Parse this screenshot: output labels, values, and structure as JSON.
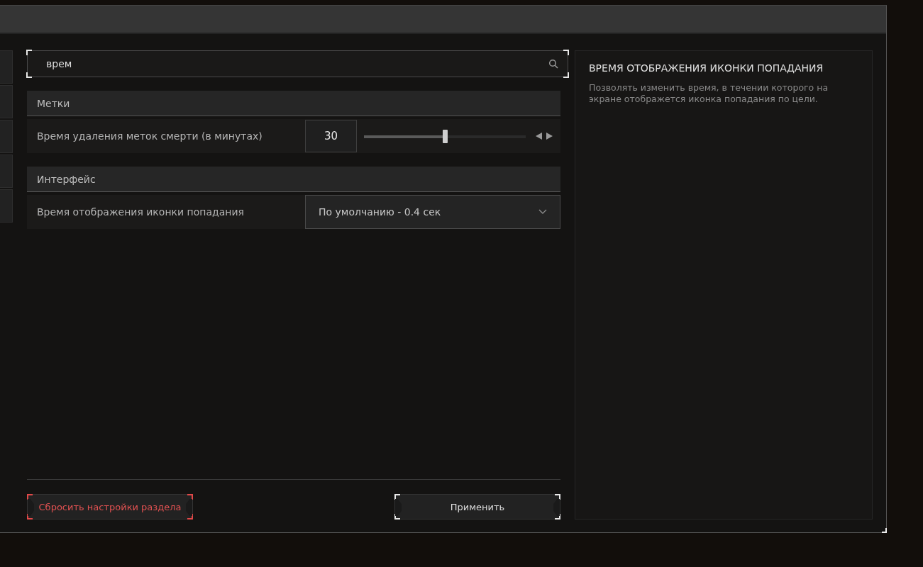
{
  "search": {
    "value": "врем"
  },
  "sections": [
    {
      "title": "Метки",
      "settings": [
        {
          "kind": "slider",
          "label": "Время удаления меток смерти (в минутах)",
          "value": "30",
          "level": 0.5
        }
      ]
    },
    {
      "title": "Интерфейс",
      "settings": [
        {
          "kind": "dropdown",
          "label": "Время отображения иконки попадания",
          "value": "По умолчанию - 0.4 сек"
        }
      ]
    }
  ],
  "info_panel": {
    "title": "ВРЕМЯ ОТОБРАЖЕНИЯ ИКОНКИ ПОПАДАНИЯ",
    "description": "Позволять изменить время, в течении которого на экране отображется иконка попадания по цели."
  },
  "buttons": [
    {
      "kind": "reset",
      "label": "Сбросить настройки раздела"
    },
    {
      "kind": "apply",
      "label": "Применить"
    }
  ]
}
